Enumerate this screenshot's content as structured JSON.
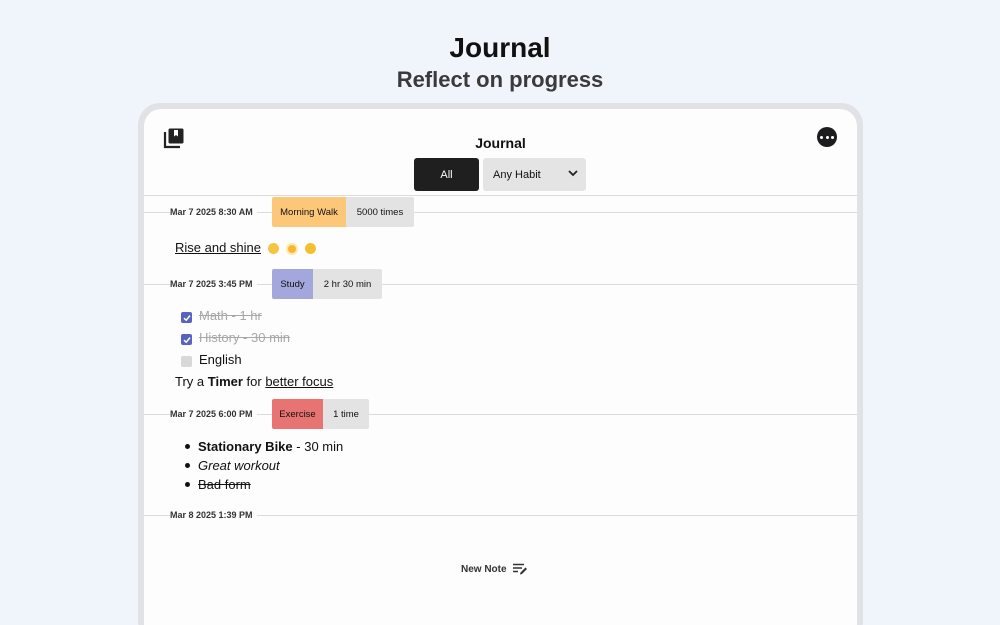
{
  "hero": {
    "title": "Journal",
    "subtitle": "Reflect on progress"
  },
  "nav": {
    "title": "Journal",
    "left_icon": "journal-bookmark-icon",
    "right_icon": "more-ellipsis-icon"
  },
  "filters": {
    "all_label": "All",
    "habit_label": "Any Habit",
    "habit_icon": "chevron-down-icon"
  },
  "entries": [
    {
      "timestamp": "Mar 7 2025 8:30 AM",
      "habit": "Morning Walk",
      "value": "5000 times",
      "color": "#fdc77a",
      "note": {
        "text": "Rise and shine",
        "emojis": [
          "slightly-smiling-face",
          "sun",
          "grinning-face"
        ]
      }
    },
    {
      "timestamp": "Mar 7 2025 3:45 PM",
      "habit": "Study",
      "value": "2 hr 30 min",
      "color": "#a3a7dc",
      "checklist": [
        {
          "text": "Math - 1 hr",
          "checked": true
        },
        {
          "text": "History - 30 min",
          "checked": true
        },
        {
          "text": "English",
          "checked": false
        }
      ],
      "tip": {
        "prefix": "Try a ",
        "bold": "Timer",
        "middle": " for ",
        "link": "better focus"
      }
    },
    {
      "timestamp": "Mar 7 2025 6:00 PM",
      "habit": "Exercise",
      "value": "1 time",
      "color": "#e87373",
      "bullets": [
        {
          "bold": "Stationary Bike",
          "rest": " - 30 min"
        },
        {
          "italic": "Great workout"
        },
        {
          "strike": "Bad form"
        }
      ]
    },
    {
      "timestamp": "Mar 8 2025 1:39 PM"
    }
  ],
  "new_note": {
    "label": "New Note",
    "icon": "compose-list-icon"
  }
}
